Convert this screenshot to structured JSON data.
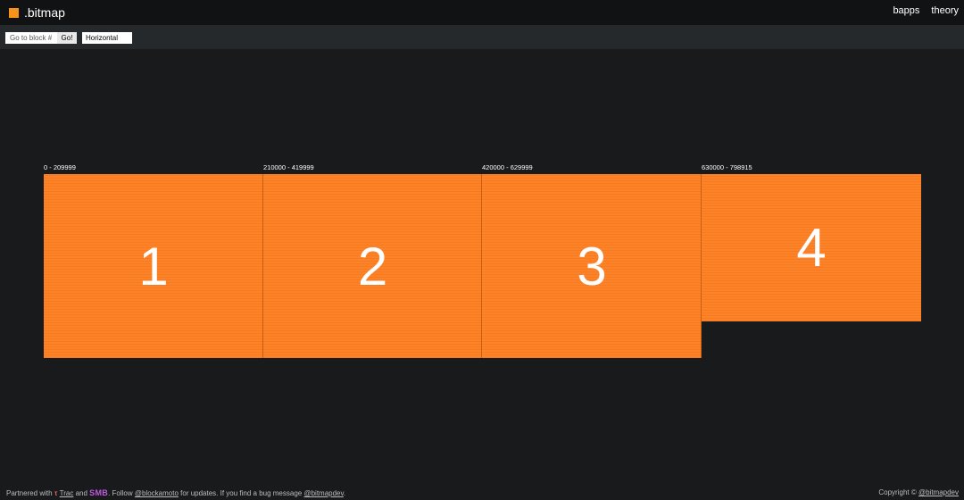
{
  "header": {
    "brand": ".bitmap",
    "brand_color": "#f7931a",
    "nav": [
      "bapps",
      "theory"
    ]
  },
  "toolbar": {
    "goto_placeholder": "Go to block #",
    "go_label": "Go!",
    "orientation": "Horizontal"
  },
  "blocks": [
    {
      "range": "0 - 209999",
      "number": "1",
      "fill": 1.0
    },
    {
      "range": "210000 - 419999",
      "number": "2",
      "fill": 1.0
    },
    {
      "range": "420000 - 629999",
      "number": "3",
      "fill": 1.0
    },
    {
      "range": "630000 - 798915",
      "number": "4",
      "fill": 0.8
    }
  ],
  "block_color": "#ff8226",
  "footer": {
    "partnered": "Partnered with",
    "trac": "Trac",
    "and": "and",
    "smb": "SMB",
    "follow": ". Follow",
    "handle1": "@blockamoto",
    "updates": "for updates. If you find a bug message",
    "handle2": "@bitmapdev",
    "period": ".",
    "copyright": "Copyright ©",
    "handle3": "@bitmapdev"
  }
}
